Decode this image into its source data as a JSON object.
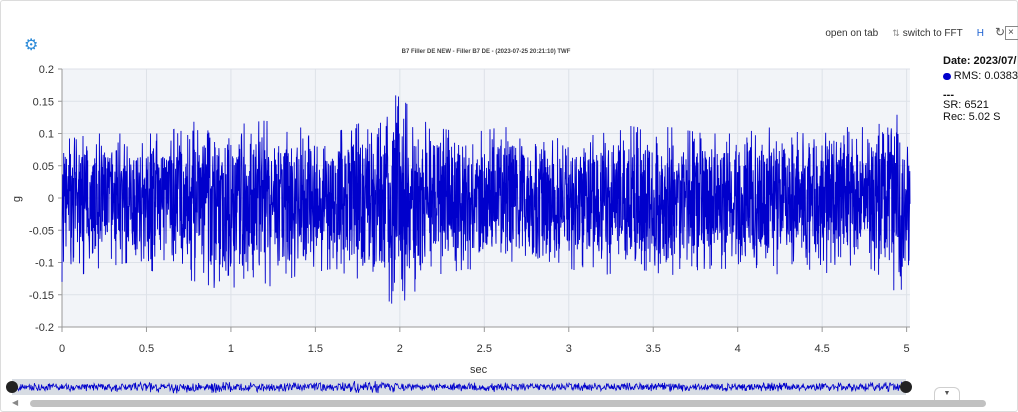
{
  "toolbar": {
    "open_on_tab": "open on tab",
    "switch_to_fft": "switch to FFT",
    "h_label": "H"
  },
  "legend": {
    "date": "Date: 2023/07/",
    "rms": "RMS: 0.0383",
    "separator": "---",
    "sr": "SR: 6521",
    "rec": "Rec: 5.02 S"
  },
  "colors": {
    "series": "#0000cc",
    "plot_bg": "#f2f4f8",
    "navigator_bg": "#d7dce3"
  },
  "icons": {
    "settings": "gear-icon",
    "fft": "fft-icon",
    "refresh": "refresh-icon",
    "close": "close-icon",
    "dropdown": "chevron-down-icon"
  },
  "chart_data": {
    "type": "line",
    "title": "B7 Filler DE NEW - Filler B7 DE - (2023-07-25 20:21:10) TWF",
    "xlabel": "sec",
    "ylabel": "g",
    "xlim": [
      0,
      5.02
    ],
    "ylim": [
      -0.2,
      0.2
    ],
    "x_ticks": [
      "0",
      "0.5",
      "1",
      "1.5",
      "2",
      "2.5",
      "3",
      "3.5",
      "4",
      "4.5",
      "5"
    ],
    "y_ticks": [
      "0.2",
      "0.15",
      "0.1",
      "0.05",
      "0",
      "-0.05",
      "-0.1",
      "-0.15",
      "-0.2"
    ],
    "grid": true,
    "legend_position": "right",
    "series": [
      {
        "name": "RMS: 0.0383",
        "x": [
          0,
          0.2,
          0.4,
          0.6,
          0.8,
          0.93,
          1.2,
          1.4,
          1.6,
          1.8,
          1.98,
          2.2,
          2.4,
          2.6,
          2.8,
          3.0,
          3.2,
          3.4,
          3.6,
          3.8,
          4.0,
          4.2,
          4.4,
          4.6,
          4.8,
          4.95,
          5.02
        ],
        "envelope_max": [
          0.09,
          0.1,
          0.1,
          0.1,
          0.12,
          0.11,
          0.12,
          0.11,
          0.1,
          0.12,
          0.16,
          0.11,
          0.1,
          0.11,
          0.11,
          0.1,
          0.12,
          0.11,
          0.11,
          0.1,
          0.1,
          0.11,
          0.1,
          0.11,
          0.11,
          0.13,
          0.11
        ],
        "envelope_min": [
          -0.13,
          -0.11,
          -0.1,
          -0.12,
          -0.13,
          -0.16,
          -0.14,
          -0.12,
          -0.11,
          -0.13,
          -0.17,
          -0.12,
          -0.11,
          -0.12,
          -0.12,
          -0.11,
          -0.12,
          -0.11,
          -0.12,
          -0.11,
          -0.11,
          -0.12,
          -0.11,
          -0.12,
          -0.11,
          -0.15,
          -0.12
        ]
      }
    ]
  }
}
